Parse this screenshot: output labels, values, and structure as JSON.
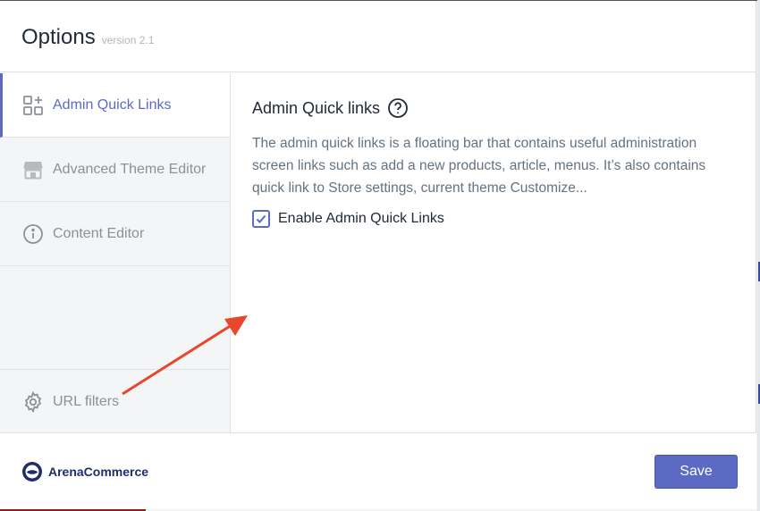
{
  "header": {
    "title": "Options",
    "version": "version 2.1"
  },
  "sidebar": {
    "items": [
      {
        "label": "Admin Quick Links",
        "icon": "apps-add-icon",
        "active": true
      },
      {
        "label": "Advanced Theme Editor",
        "icon": "storefront-icon",
        "active": false
      },
      {
        "label": "Content Editor",
        "icon": "info-icon",
        "active": false
      },
      {
        "label": "URL filters",
        "icon": "gear-icon",
        "active": false
      }
    ]
  },
  "content": {
    "title": "Admin Quick links",
    "help_icon": "question-circle-icon",
    "description": "The admin quick links is a floating bar that contains useful administration screen links such as add a new products, article, menus. It’s also contains quick link to Store settings, current theme Customize...",
    "checkbox": {
      "label": "Enable Admin Quick Links",
      "checked": true
    }
  },
  "footer": {
    "brand": "ArenaCommerce",
    "save_label": "Save"
  },
  "colors": {
    "accent": "#5c6ac4",
    "annotation_arrow": "#e8472c"
  }
}
